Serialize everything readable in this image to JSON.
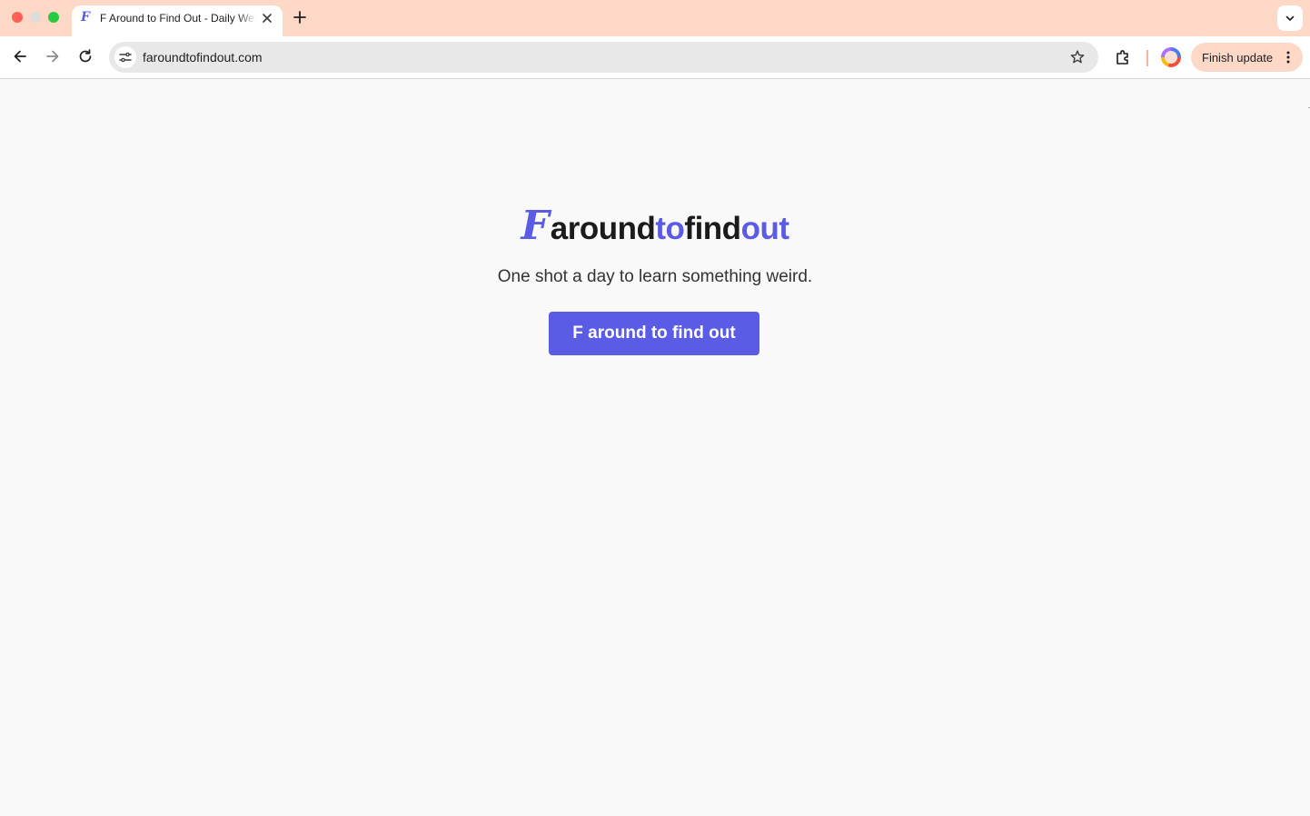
{
  "browser": {
    "tab": {
      "favicon_glyph": "F",
      "title": "F Around to Find Out - Daily Weird Facts"
    },
    "address_bar": {
      "url": "faroundtofindout.com"
    },
    "update_button": {
      "label": "Finish update"
    },
    "icons": {
      "close": "close-icon",
      "new_tab": "plus-icon",
      "tab_search": "chevron-down-icon",
      "back": "arrow-left-icon",
      "forward": "arrow-right-icon",
      "reload": "reload-icon",
      "site_info": "tune-icon",
      "bookmark": "star-icon",
      "extensions": "puzzle-icon",
      "menu": "kebab-icon"
    },
    "colors": {
      "tabstrip": "#fdd8c6",
      "accent": "#5b5ce6"
    }
  },
  "page": {
    "logo": {
      "glyph": "F",
      "part1": "around",
      "part2": "to",
      "part3": "find",
      "part4": "out"
    },
    "tagline": "One shot a day to learn something weird.",
    "cta_label": "F around to find out"
  }
}
